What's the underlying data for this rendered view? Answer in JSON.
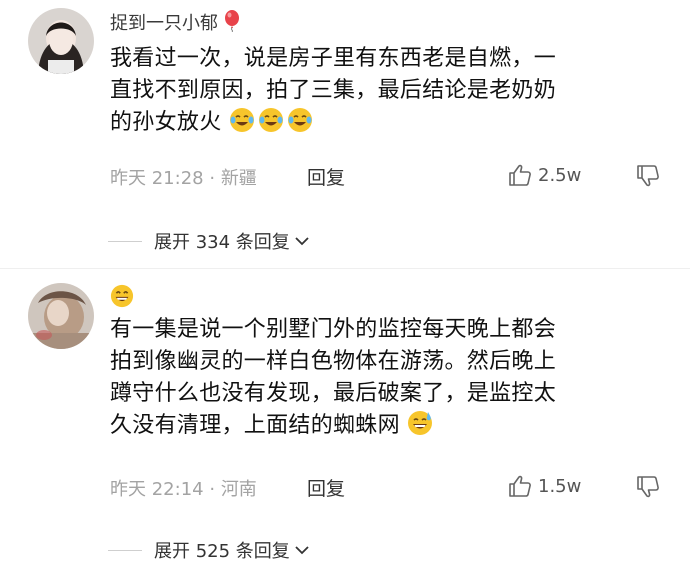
{
  "comments": [
    {
      "username": "捉到一只小郁",
      "text_line1": "我看过一次，说是房子里有东西老是自燃，一",
      "text_line2": "直找不到原因，拍了三集，最后结论是老奶奶",
      "text_line3": "的孙女放火",
      "time": "昨天 21:28",
      "location": "新疆",
      "reply_label": "回复",
      "likes": "2.5w",
      "expand_label": "展开 334 条回复"
    },
    {
      "username": "",
      "text_line1": "有一集是说一个别墅门外的监控每天晚上都会",
      "text_line2": "拍到像幽灵的一样白色物体在游荡。然后晚上",
      "text_line3": "蹲守什么也没有发现，最后破案了，是监控太",
      "text_line4": "久没有清理，上面结的蜘蛛网",
      "time": "昨天 22:14",
      "location": "河南",
      "reply_label": "回复",
      "likes": "1.5w",
      "expand_label": "展开 525 条回复"
    }
  ],
  "icons": {
    "username_badge": "balloon-icon",
    "like": "thumbs-up-icon",
    "dislike": "thumbs-down-icon",
    "expand": "chevron-down-icon"
  },
  "colors": {
    "meta_text": "#a3a3a3",
    "text": "#111111",
    "accent_balloon": "#e8434a"
  }
}
